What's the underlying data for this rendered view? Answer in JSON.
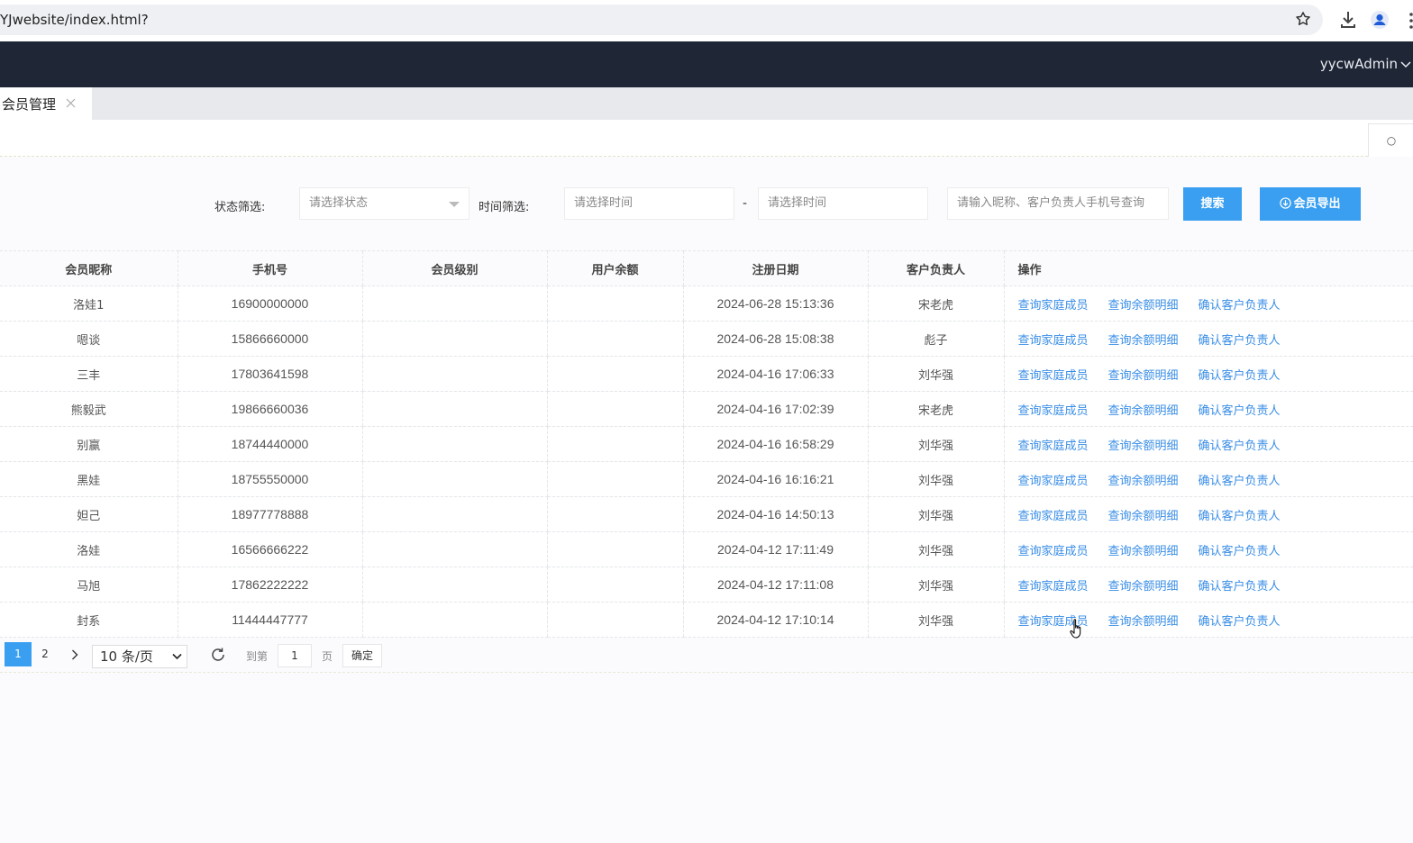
{
  "browser": {
    "url": "YJwebsite/index.html?"
  },
  "header": {
    "username": "yycwAdmin"
  },
  "tabs": [
    {
      "label": "会员管理"
    }
  ],
  "toolbar": {
    "refresh_label": "○"
  },
  "filters": {
    "status_label": "状态筛选:",
    "status_placeholder": "请选择状态",
    "time_label": "时间筛选:",
    "time_start_placeholder": "请选择时间",
    "time_separator": "-",
    "time_end_placeholder": "请选择时间",
    "keyword_placeholder": "请输入昵称、客户负责人手机号查询",
    "search_button": "搜索",
    "export_button": "会员导出"
  },
  "table": {
    "columns": [
      "会员昵称",
      "手机号",
      "会员级别",
      "用户余额",
      "注册日期",
      "客户负责人",
      "操作"
    ],
    "rows": [
      {
        "nickname": "洛娃1",
        "phone": "16900000000",
        "level": "",
        "balance": "",
        "date": "2024-06-28 15:13:36",
        "manager": "宋老虎"
      },
      {
        "nickname": "嗯谈",
        "phone": "15866660000",
        "level": "",
        "balance": "",
        "date": "2024-06-28 15:08:38",
        "manager": "彪子"
      },
      {
        "nickname": "三丰",
        "phone": "17803641598",
        "level": "",
        "balance": "",
        "date": "2024-04-16 17:06:33",
        "manager": "刘华强"
      },
      {
        "nickname": "熊毅武",
        "phone": "19866660036",
        "level": "",
        "balance": "",
        "date": "2024-04-16 17:02:39",
        "manager": "宋老虎"
      },
      {
        "nickname": "别赢",
        "phone": "18744440000",
        "level": "",
        "balance": "",
        "date": "2024-04-16 16:58:29",
        "manager": "刘华强"
      },
      {
        "nickname": "黑娃",
        "phone": "18755550000",
        "level": "",
        "balance": "",
        "date": "2024-04-16 16:16:21",
        "manager": "刘华强"
      },
      {
        "nickname": "妲己",
        "phone": "18977778888",
        "level": "",
        "balance": "",
        "date": "2024-04-16 14:50:13",
        "manager": "刘华强"
      },
      {
        "nickname": "洛娃",
        "phone": "16566666222",
        "level": "",
        "balance": "",
        "date": "2024-04-12 17:11:49",
        "manager": "刘华强"
      },
      {
        "nickname": "马旭",
        "phone": "17862222222",
        "level": "",
        "balance": "",
        "date": "2024-04-12 17:11:08",
        "manager": "刘华强"
      },
      {
        "nickname": "封系",
        "phone": "11444447777",
        "level": "",
        "balance": "",
        "date": "2024-04-12 17:10:14",
        "manager": "刘华强"
      }
    ],
    "actions": [
      "查询家庭成员",
      "查询余额明细",
      "确认客户负责人"
    ]
  },
  "pagination": {
    "pages": [
      "1",
      "2"
    ],
    "current": "1",
    "next_label": "›",
    "page_size": "10 条/页",
    "goto_label": "到第",
    "goto_value": "1",
    "page_unit": "页",
    "confirm_label": "确定"
  },
  "colors": {
    "header_bg": "#1f2636",
    "primary": "#3a9ff0",
    "link": "#3a8ee6"
  }
}
